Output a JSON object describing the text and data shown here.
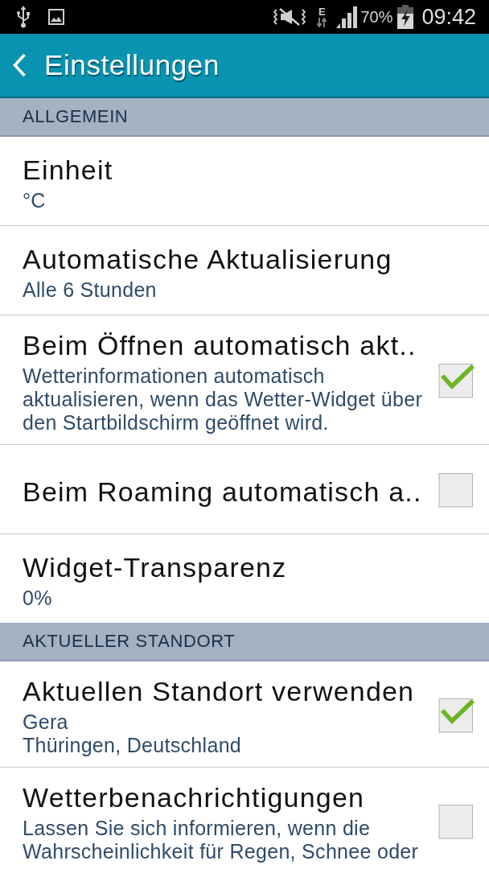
{
  "status_bar": {
    "network_type": "E",
    "battery": "70%",
    "time": "09:42"
  },
  "header": {
    "title": "Einstellungen"
  },
  "sections": [
    {
      "title": "ALLGEMEIN",
      "items": [
        {
          "kind": "value",
          "title": "Einheit",
          "summary": [
            "°C"
          ]
        },
        {
          "kind": "value",
          "title": "Automatische Aktualisierung",
          "summary": [
            "Alle 6 Stunden"
          ]
        },
        {
          "kind": "toggle",
          "title": "Beim Öffnen automatisch akt..",
          "summary": [
            "Wetterinformationen automatisch aktualisieren, wenn das Wetter-Widget über den Startbildschirm geöffnet wird."
          ],
          "checked": true
        },
        {
          "kind": "toggle",
          "title": "Beim Roaming automatisch a..",
          "checked": false
        },
        {
          "kind": "value",
          "title": "Widget-Transparenz",
          "summary": [
            "0%"
          ]
        }
      ]
    },
    {
      "title": "AKTUELLER STANDORT",
      "items": [
        {
          "kind": "toggle",
          "title": "Aktuellen Standort verwenden",
          "summary": [
            "Gera",
            "Thüringen, Deutschland"
          ],
          "checked": true
        },
        {
          "kind": "toggle",
          "title": "Wetterbenachrichtigungen",
          "summary": [
            "Lassen Sie sich informieren, wenn die Wahrscheinlichkeit für Regen, Schnee oder"
          ],
          "checked": false
        }
      ]
    }
  ]
}
